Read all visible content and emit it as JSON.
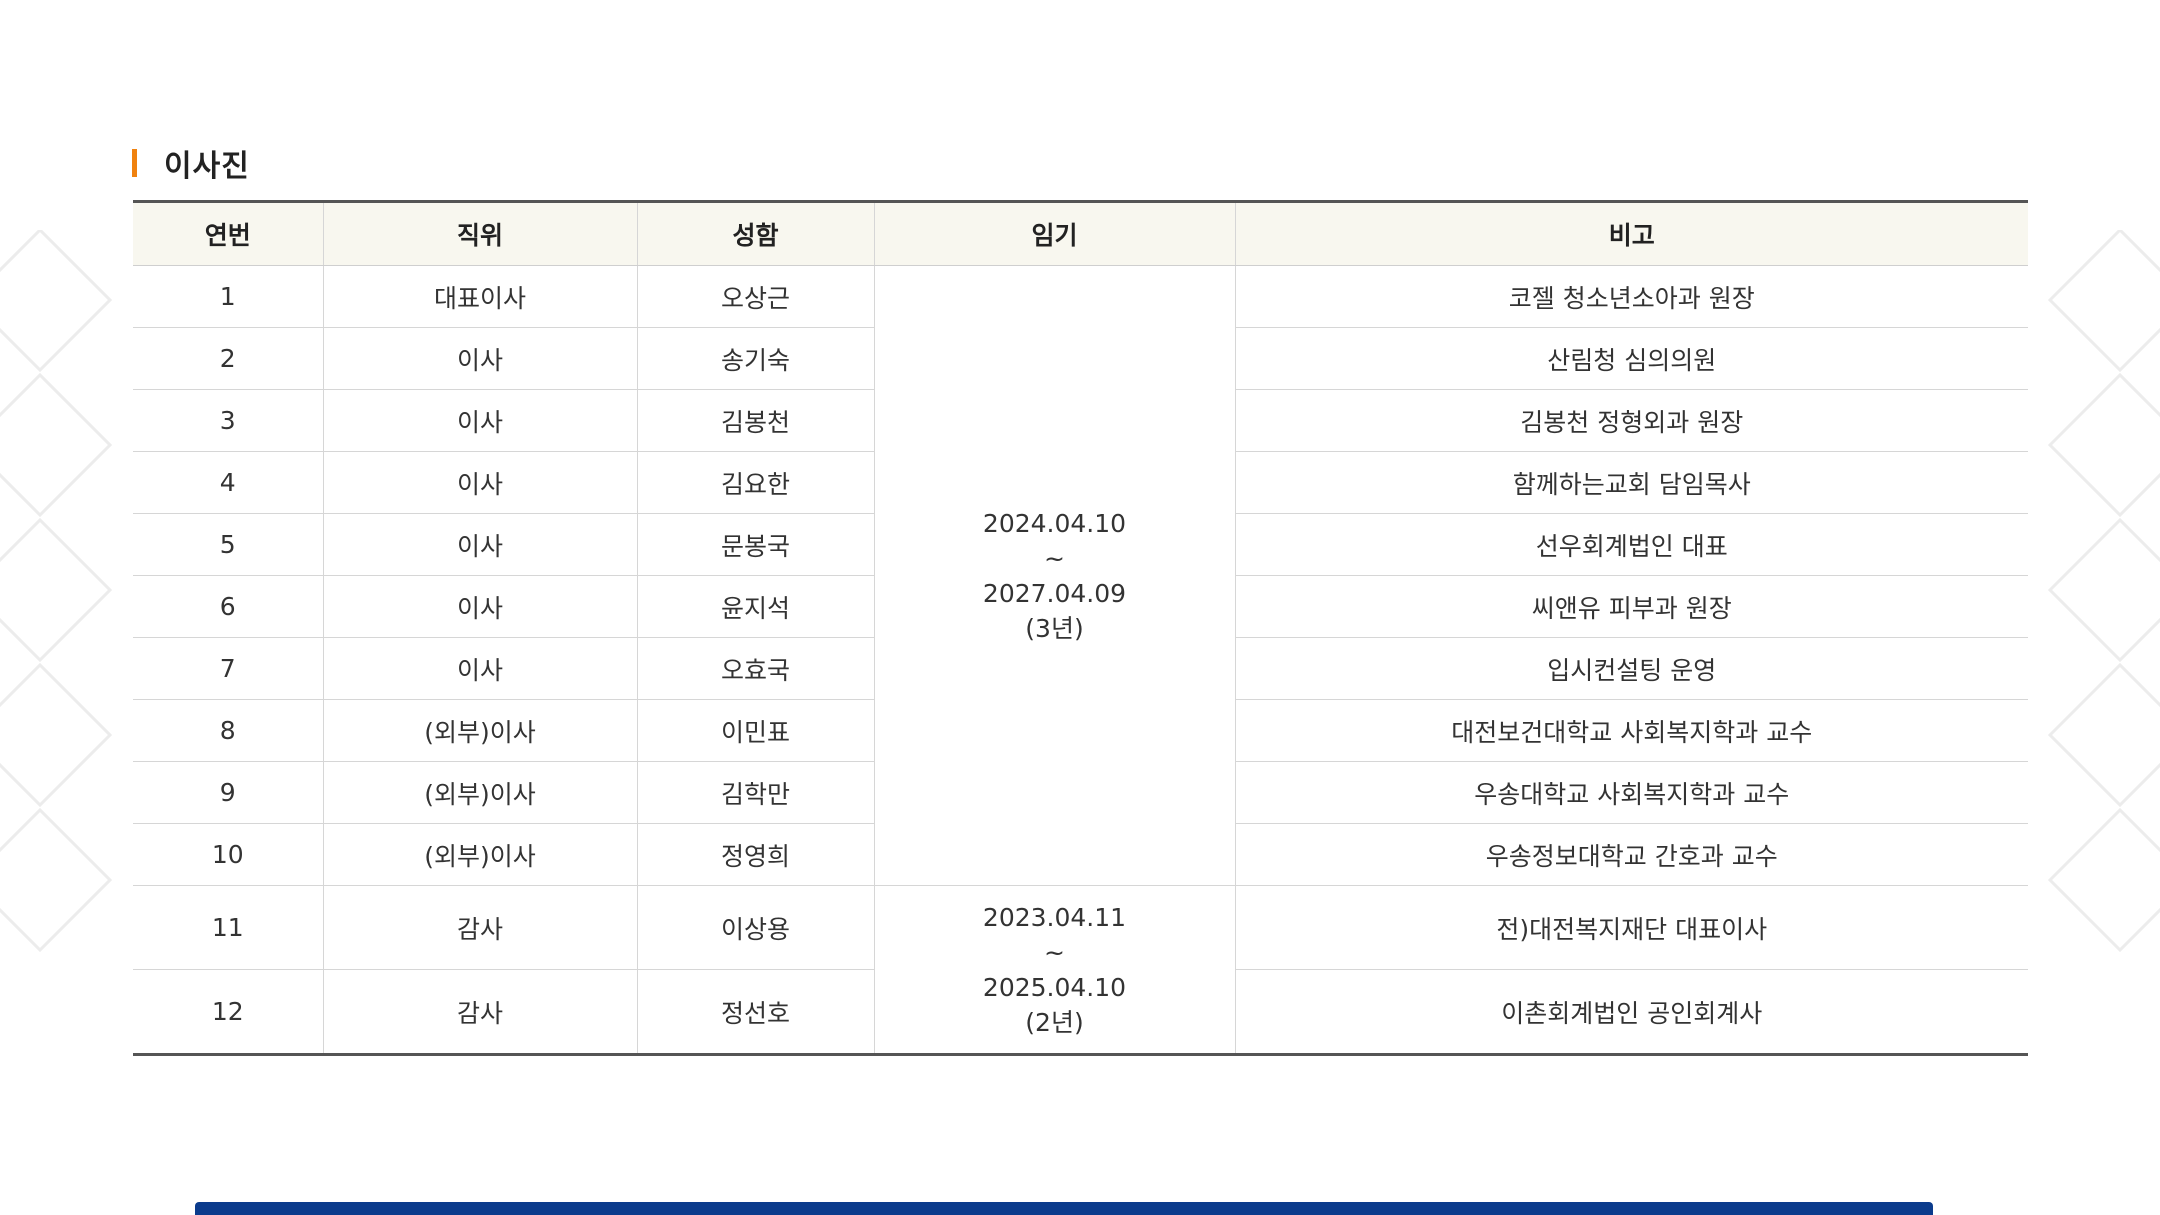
{
  "section": {
    "title": "이사진"
  },
  "table": {
    "headers": {
      "no": "연번",
      "position": "직위",
      "name": "성함",
      "term": "임기",
      "note": "비고"
    },
    "rows": [
      {
        "no": "1",
        "position": "대표이사",
        "name": "오상근",
        "note": "코젤 청소년소아과 원장"
      },
      {
        "no": "2",
        "position": "이사",
        "name": "송기숙",
        "note": "산림청 심의의원"
      },
      {
        "no": "3",
        "position": "이사",
        "name": "김봉천",
        "note": "김봉천 정형외과 원장"
      },
      {
        "no": "4",
        "position": "이사",
        "name": "김요한",
        "note": "함께하는교회 담임목사"
      },
      {
        "no": "5",
        "position": "이사",
        "name": "문봉국",
        "note": "선우회계법인 대표"
      },
      {
        "no": "6",
        "position": "이사",
        "name": "윤지석",
        "note": "씨앤유 피부과 원장"
      },
      {
        "no": "7",
        "position": "이사",
        "name": "오효국",
        "note": "입시컨설팅 운영"
      },
      {
        "no": "8",
        "position": "(외부)이사",
        "name": "이민표",
        "note": "대전보건대학교 사회복지학과 교수"
      },
      {
        "no": "9",
        "position": "(외부)이사",
        "name": "김학만",
        "note": "우송대학교 사회복지학과 교수"
      },
      {
        "no": "10",
        "position": "(외부)이사",
        "name": "정영희",
        "note": "우송정보대학교 간호과 교수"
      },
      {
        "no": "11",
        "position": "감사",
        "name": "이상용",
        "note": "전)대전복지재단 대표이사"
      },
      {
        "no": "12",
        "position": "감사",
        "name": "정선호",
        "note": "이촌회계법인 공인회계사"
      }
    ],
    "terms": [
      {
        "start": "2024.04.10",
        "sep": "~",
        "end": "2027.04.09",
        "length": "(3년)"
      },
      {
        "start": "2023.04.11",
        "sep": "~",
        "end": "2025.04.10",
        "length": "(2년)"
      }
    ]
  },
  "colors": {
    "accent": "#f0820f",
    "header_bg": "#f8f7ef",
    "bottom_bar": "#0b3b8c"
  }
}
